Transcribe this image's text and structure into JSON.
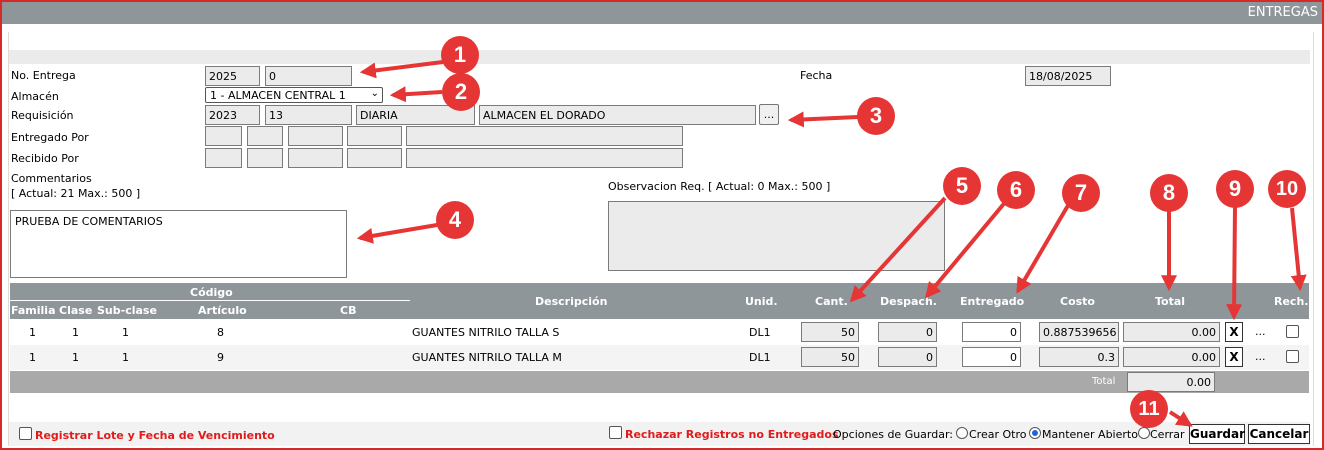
{
  "window": {
    "title": "ENTREGAS"
  },
  "form": {
    "no_entrega_label": "No. Entrega",
    "no_entrega_year": "2025",
    "no_entrega_number": "0",
    "fecha_label": "Fecha",
    "fecha_value": "18/08/2025",
    "almacen_label": "Almacén",
    "almacen_selected": "1 - ALMACEN CENTRAL 1",
    "requisicion_label": "Requisición",
    "req_year": "2023",
    "req_number": "13",
    "req_type": "DIARIA",
    "req_warehouse": "ALMACEN EL DORADO",
    "req_lookup_label": "...",
    "entregado_por_label": "Entregado Por",
    "recibido_por_label": "Recibido Por",
    "commentarios_label": "Commentarios",
    "commentarios_counter": "[ Actual: 21   Max.: 500 ]",
    "comments_value": "PRUEBA DE COMENTARIOS",
    "observacion_label": "Observacion Req. [ Actual: 0   Max.: 500 ]",
    "observacion_value": ""
  },
  "table": {
    "headers": {
      "codigo": "Código",
      "familia": "Familia",
      "clase": "Clase",
      "subclase": "Sub-clase",
      "articulo": "Artículo",
      "cb": "CB",
      "descripcion": "Descripción",
      "unid": "Unid.",
      "cant": "Cant.",
      "despach": "Despach.",
      "entregado": "Entregado",
      "costo": "Costo",
      "total": "Total",
      "rech": "Rech."
    },
    "rows": [
      {
        "familia": "1",
        "clase": "1",
        "subclase": "1",
        "articulo": "8",
        "cb": "",
        "descripcion": "GUANTES NITRILO TALLA S",
        "unid": "DL1",
        "cant": "50",
        "despach": "0",
        "entregado": "0",
        "costo": "0.887539656",
        "total": "0.00",
        "remove": "X",
        "more": "...",
        "rech": false
      },
      {
        "familia": "1",
        "clase": "1",
        "subclase": "1",
        "articulo": "9",
        "cb": "",
        "descripcion": "GUANTES NITRILO TALLA M",
        "unid": "DL1",
        "cant": "50",
        "despach": "0",
        "entregado": "0",
        "costo": "0.3",
        "total": "0.00",
        "remove": "X",
        "more": "...",
        "rech": false
      }
    ],
    "total_label": "Total",
    "total_value": "0.00"
  },
  "footer": {
    "registrar_lote": "Registrar Lote y Fecha de Vencimiento",
    "rechazar": "Rechazar Registros no Entregados",
    "opciones_label": "Opciones de Guardar:",
    "opt_crear": "Crear Otro",
    "opt_mantener": "Mantener Abierto",
    "opt_cerrar": "Cerrar",
    "guardar": "Guardar",
    "cancelar": "Cancelar"
  },
  "annotations": [
    "1",
    "2",
    "3",
    "4",
    "5",
    "6",
    "7",
    "8",
    "9",
    "10",
    "11"
  ],
  "colors": {
    "header_gray": "#8f969a",
    "annotation_red": "#e53535",
    "label_red": "#e01b1b"
  }
}
